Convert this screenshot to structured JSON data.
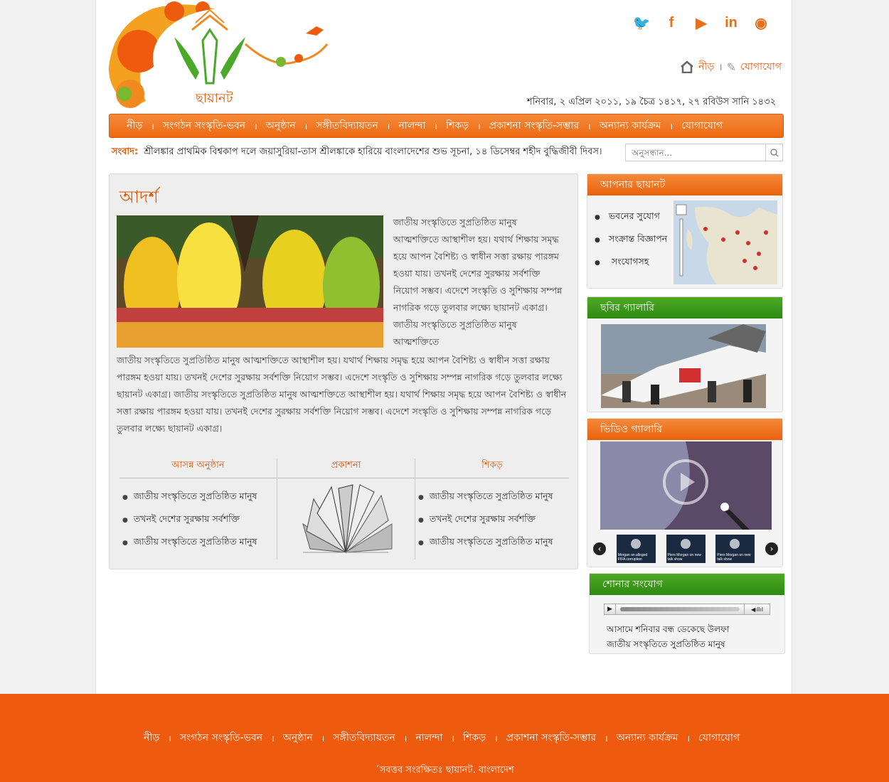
{
  "social": [
    "twitter-icon",
    "facebook-icon",
    "youtube-icon",
    "linkedin-icon",
    "rss-icon"
  ],
  "toplinks": {
    "home": "নীড়",
    "sep": "।",
    "contact": "যোগাযোগ"
  },
  "date": "শনিবার, ২ এপ্রিল ২০১১, ১৯ চৈত্র ১৪১৭, ২৭ রবিউস সানি ১৪৩২",
  "logo_text": "ছায়ানট",
  "nav": [
    "নীড়",
    "সংগঠন  সংস্কৃতি-ভবন",
    "অনুষ্ঠান",
    "সঙ্গীতবিদ্যায়তন",
    "নালন্দা",
    "শিকড়",
    "প্রকাশনা সংস্কৃতি-সম্ভার",
    "অন্যান্য কার্যক্রম",
    "যোগাযোগ"
  ],
  "nav_sep": "।",
  "ticker": {
    "label": "সংবাদ:",
    "text": "শ্রীলঙ্কার প্রাথমিক বিশ্বকাপ দলে জয়াসুরিয়া-তাস  শ্রীলঙ্কাকে হারিয়ে বাংলাদেশের শুভ সূচনা,  ১৪ ডিসেম্বর শহীদ বুদ্ধিজীবী দিবস।"
  },
  "search": {
    "placeholder": "অনুসন্ধান..."
  },
  "main": {
    "title": "আদর্শ",
    "intro": "জাতীয় সংস্কৃতিতে সুপ্রতিষ্ঠিত মানুষ আত্মশক্তিতে আস্থাশীল হয়। যথার্থ শিক্ষায় সমৃদ্ধ হয়ে আপন বৈশিষ্ট্য ও স্বাধীন সত্তা রক্ষায় পারঙ্গম হওয়া যায়। তখনই দেশের সুরক্ষায় সর্বশক্তি নিয়োগ সম্ভব। এদেশে সংস্কৃতি ও সুশিক্ষায় সম্পন্ন নাগরিক গড়ে তুলবার লক্ষ্যে ছায়ানট একাগ্র।  জাতীয় সংস্কৃতিতে সুপ্রতিষ্ঠিত মানুষ আত্মশক্তিতে",
    "body": "জাতীয় সংস্কৃতিতে সুপ্রতিষ্ঠিত মানুষ আত্মশক্তিতে আস্থাশীল হয়। যথার্থ শিক্ষায় সমৃদ্ধ হয়ে আপন বৈশিষ্ট্য ও স্বাধীন সত্তা রক্ষায় পারঙ্গম হওয়া যায়। তখনই দেশের সুরক্ষায় সর্বশক্তি নিয়োগ সম্ভব। এদেশে সংস্কৃতি ও সুশিক্ষায় সম্পন্ন নাগরিক গড়ে তুলবার লক্ষ্যে ছায়ানট একাগ্র।  জাতীয় সংস্কৃতিতে সুপ্রতিষ্ঠিত মানুষ আত্মশক্তিতে আস্থাশীল হয়। যথার্থ শিক্ষায় সমৃদ্ধ হয়ে আপন বৈশিষ্ট্য ও স্বাধীন সত্তা রক্ষায় পারঙ্গম হওয়া যায়। তখনই দেশের সুরক্ষায় সর্বশক্তি নিয়োগ সম্ভব। এদেশে সংস্কৃতি ও সুশিক্ষায় সম্পন্ন নাগরিক গড়ে তুলবার লক্ষ্যে ছায়ানট একাগ্র।",
    "columns": {
      "events": {
        "title": "আসন্ন অনুষ্ঠান",
        "items": [
          "জাতীয় সংস্কৃতিতে সুপ্রতিষ্ঠিত মানুষ",
          "তখনই দেশের সুরক্ষায় সর্বশক্তি",
          "জাতীয় সংস্কৃতিতে সুপ্রতিষ্ঠিত মানুষ"
        ]
      },
      "publication": {
        "title": "প্রকাশনা"
      },
      "shikor": {
        "title": "শিকড়",
        "items": [
          "জাতীয় সংস্কৃতিতে সুপ্রতিষ্ঠিত মানুষ",
          "তখনই দেশের সুরক্ষায় সর্বশক্তি",
          "জাতীয় সংস্কৃতিতে সুপ্রতিষ্ঠিত মানুষ"
        ]
      }
    }
  },
  "sidebar": {
    "your_chhayanaut": {
      "title": "আপনার ছায়ানট",
      "items": [
        "ভবনের সুযোগ",
        "সংক্রান্ত বিজ্ঞাপন",
        " সংযোগসহ"
      ]
    },
    "photo_gallery": {
      "title": "ছবির গ্যালারি"
    },
    "video_gallery": {
      "title": "ভিডিও গ্যালারি",
      "thumbs": [
        "Morgan on alleged FIFA corruption",
        "Piers Morgan on new talk show",
        "Piers Morgan on new talk show"
      ]
    },
    "audio": {
      "title": "শোনার সংযোগ",
      "lines": [
        "আসামে শনিবার বন্ধ ডেকেছে উলফা",
        "জাতীয় সংস্কৃতিতে সুপ্রতিষ্ঠিত মানুষ"
      ]
    }
  },
  "footer": {
    "nav": [
      "নীড়",
      "সংগঠন  সংস্কৃতি-ভবন",
      "অনুষ্ঠান",
      "সঙ্গীতবিদ্যায়তন",
      "নালন্দা",
      "শিকড়",
      "প্রকাশনা সংস্কৃতি-সম্ভার",
      "অন্যান্য কার্যক্রম",
      "যোগাযোগ"
    ],
    "copyright": "´সবত্তব সংরক্ষিতঃ ছায়ানট. বাংলাদেশ"
  },
  "colors": {
    "accent": "#ee5a0e",
    "green": "#3a9a1a"
  }
}
